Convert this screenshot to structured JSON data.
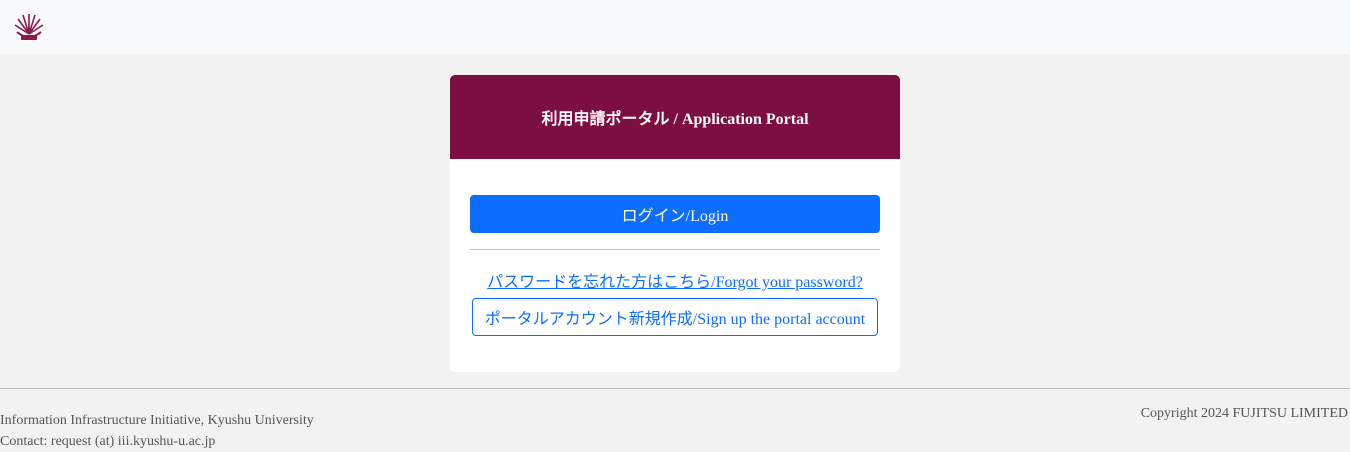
{
  "header": {
    "logo_icon": "kyushu-university-logo-icon",
    "brand_color": "#7d0e42"
  },
  "card": {
    "title": "利用申請ポータル / Application Portal",
    "login_label": "ログイン/Login",
    "forgot_label": "パスワードを忘れた方はこちら/Forgot your password?",
    "signup_label": "ポータルアカウント新規作成/Sign up the portal account"
  },
  "footer": {
    "org": "Information Infrastructure Initiative, Kyushu University",
    "contact": "Contact: request (at) iii.kyushu-u.ac.jp",
    "copyright": "Copyright 2024 FUJITSU LIMITED"
  },
  "colors": {
    "primary": "#0d6efd",
    "header_bg": "#7d0e42"
  }
}
